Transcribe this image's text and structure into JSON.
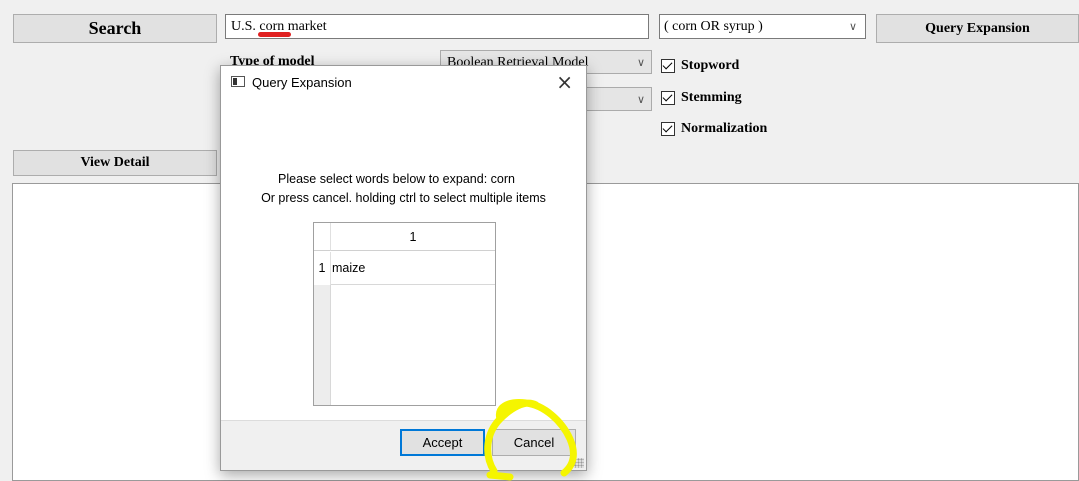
{
  "main": {
    "search_button": "Search",
    "query_input_value": "U.S. corn market",
    "expansion_select_value": "( corn OR syrup )",
    "query_expansion_button": "Query Expansion",
    "model_label": "Type of model",
    "model_select_value": "Boolean Retrieval Model",
    "stopword_label": "Stopword",
    "stemming_label": "Stemming",
    "normalization_label": "Normalization",
    "view_detail_button": "View Detail"
  },
  "dialog": {
    "title": "Query Expansion",
    "message_line1": "Please select words below to expand: corn",
    "message_line2": "Or press cancel. holding ctrl to select multiple items",
    "table": {
      "column_header": "1",
      "rows": [
        {
          "index": "1",
          "value": "maize"
        }
      ]
    },
    "accept_button": "Accept",
    "cancel_button": "Cancel"
  },
  "colors": {
    "spellcheck_underline": "#e02020",
    "annotation_highlight": "#f5f500",
    "focus_border": "#0078d7"
  }
}
